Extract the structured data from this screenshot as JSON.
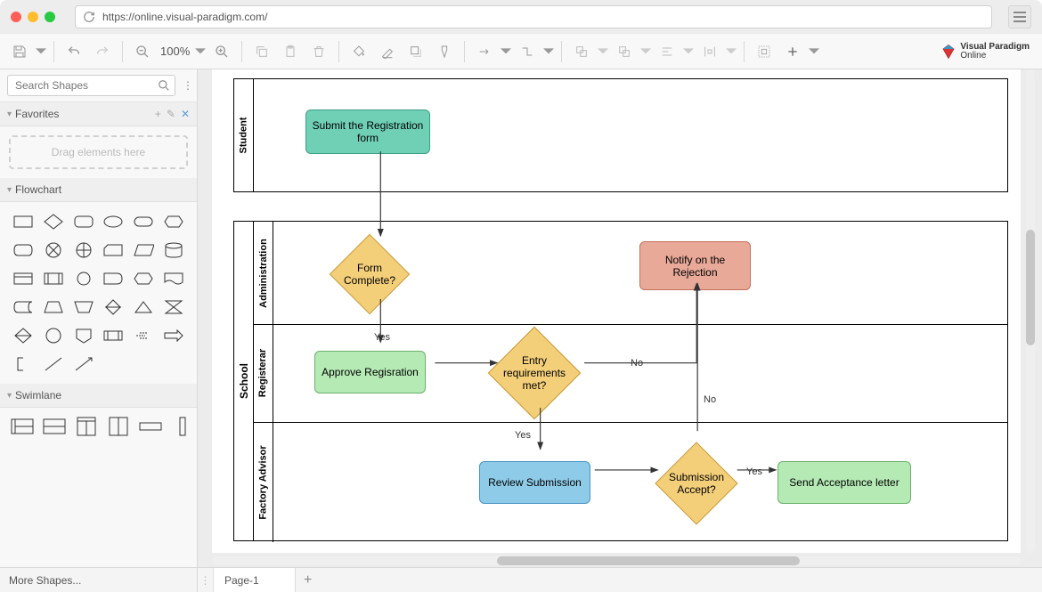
{
  "browser": {
    "url": "https://online.visual-paradigm.com/"
  },
  "toolbar": {
    "zoom": "100%"
  },
  "brand": {
    "line1": "Visual Paradigm",
    "line2": "Online"
  },
  "sidebar": {
    "search_placeholder": "Search Shapes",
    "favorites": {
      "title": "Favorites",
      "dropzone": "Drag elements here"
    },
    "flowchart": {
      "title": "Flowchart"
    },
    "swimlane": {
      "title": "Swimlane"
    }
  },
  "footer": {
    "more_shapes": "More Shapes...",
    "page_tab": "Page-1"
  },
  "diagram": {
    "pool1": {
      "lane1_title": "Student"
    },
    "pool2": {
      "title": "School",
      "lane_admin": "Administration",
      "lane_registrar": "Registerar",
      "lane_advisor": "Factory Advisor"
    },
    "nodes": {
      "submit": "Submit the Registration form",
      "form_complete": "Form Complete?",
      "approve": "Approve Regisration",
      "entry_req": "Entry requirements met?",
      "notify_reject": "Notify on the Rejection",
      "review": "Review Submission",
      "sub_accept": "Submission Accept?",
      "send_accept": "Send Acceptance letter"
    },
    "labels": {
      "yes1": "Yes",
      "yes2": "Yes",
      "yes3": "Yes",
      "no1": "No",
      "no2": "No"
    }
  }
}
